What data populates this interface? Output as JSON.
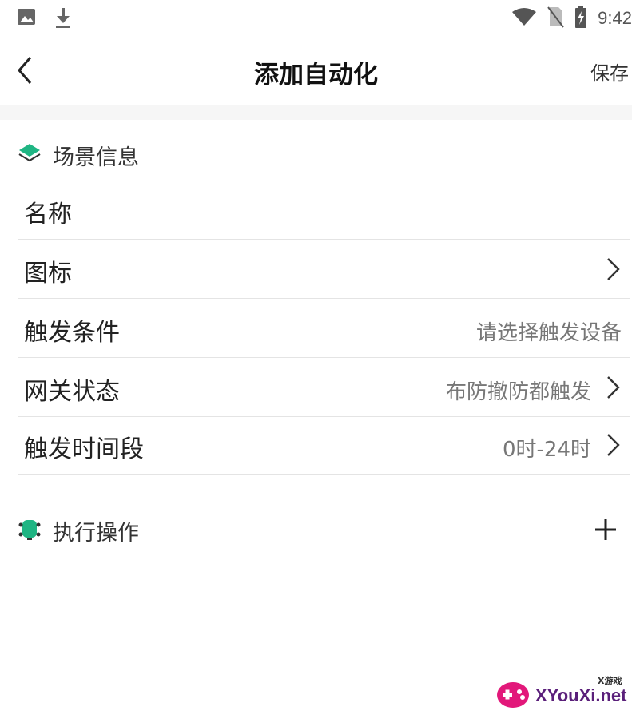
{
  "status_bar": {
    "time": "9:42",
    "icons": [
      "image-icon",
      "download-icon",
      "wifi-icon",
      "no-sim-icon",
      "battery-charging-icon"
    ]
  },
  "header": {
    "title": "添加自动化",
    "save_label": "保存",
    "back_icon": "chevron-left-icon"
  },
  "scene_info": {
    "section_title": "场景信息",
    "icon": "layers-icon",
    "rows": [
      {
        "label": "名称",
        "value": ""
      },
      {
        "label": "图标",
        "value": ""
      },
      {
        "label": "触发条件",
        "value": "请选择触发设备"
      },
      {
        "label": "网关状态",
        "value": "布防撤防都触发"
      },
      {
        "label": "触发时间段",
        "value": "0时-24时"
      }
    ]
  },
  "actions": {
    "section_title": "执行操作",
    "icon": "robot-icon",
    "add_icon": "plus-icon"
  },
  "watermark": {
    "brand": "XYouXi.net",
    "small": "X游戏"
  },
  "colors": {
    "accent": "#1fb583",
    "divider": "#e4e4e4",
    "band": "#f6f6f6"
  }
}
